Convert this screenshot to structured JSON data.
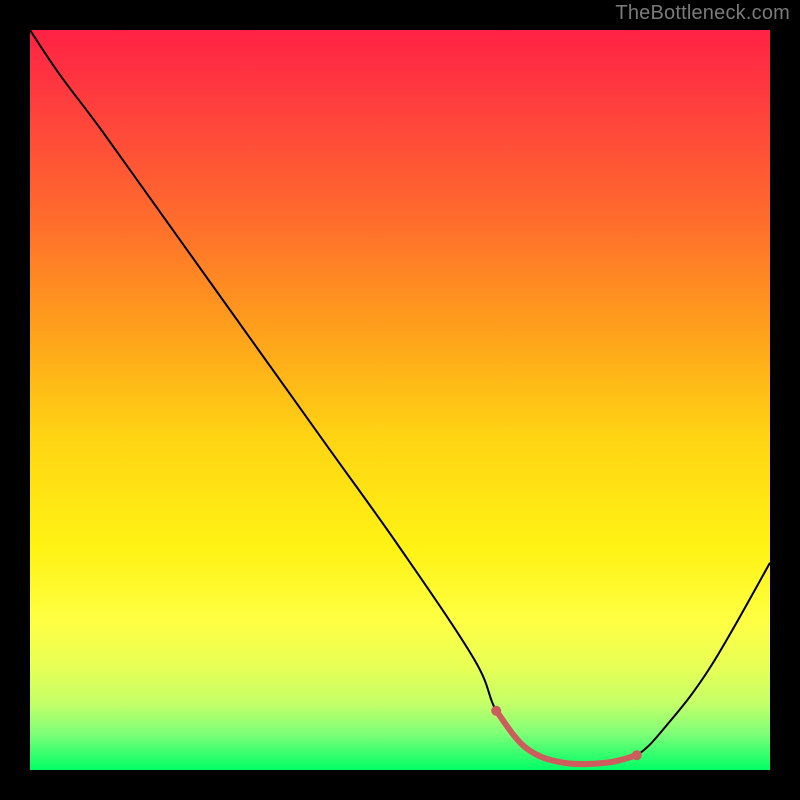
{
  "watermark": "TheBottleneck.com",
  "chart_data": {
    "type": "line",
    "title": "",
    "xlabel": "",
    "ylabel": "",
    "xlim": [
      0,
      100
    ],
    "ylim": [
      0,
      100
    ],
    "grid": false,
    "gradient_colors_top_to_bottom": [
      "#ff2244",
      "#ff3e3e",
      "#ff6a2d",
      "#ff9e1c",
      "#ffd413",
      "#fff314",
      "#e2ff4b",
      "#b7ff68",
      "#60ff86",
      "#00ff66"
    ],
    "series": [
      {
        "name": "bottleneck-curve",
        "color": "#000000",
        "x": [
          0,
          4,
          10,
          20,
          30,
          40,
          50,
          60,
          63,
          67,
          72,
          78,
          82,
          86,
          92,
          100
        ],
        "y": [
          100,
          94,
          86,
          72,
          58,
          44,
          30,
          15,
          8,
          3,
          1,
          1,
          2,
          6,
          14,
          28
        ]
      }
    ],
    "highlight": {
      "name": "bottleneck-minimum",
      "color": "#cd5c5c",
      "x": [
        63,
        67,
        72,
        78,
        82
      ],
      "y": [
        8,
        3,
        1,
        1,
        2
      ]
    }
  }
}
